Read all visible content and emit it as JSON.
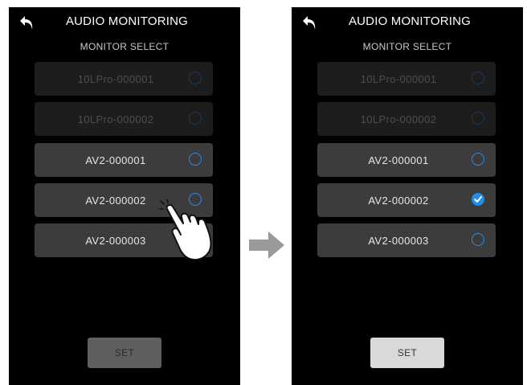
{
  "screens": [
    {
      "title": "AUDIO MONITORING",
      "subtitle": "MONITOR SELECT",
      "items": [
        {
          "label": "10LPro-000001",
          "disabled": true,
          "checked": false
        },
        {
          "label": "10LPro-000002",
          "disabled": true,
          "checked": false
        },
        {
          "label": "AV2-000001",
          "disabled": false,
          "checked": false
        },
        {
          "label": "AV2-000002",
          "disabled": false,
          "checked": false
        },
        {
          "label": "AV2-000003",
          "disabled": false,
          "checked": false
        }
      ],
      "set_label": "SET",
      "set_enabled": false
    },
    {
      "title": "AUDIO MONITORING",
      "subtitle": "MONITOR SELECT",
      "items": [
        {
          "label": "10LPro-000001",
          "disabled": true,
          "checked": false
        },
        {
          "label": "10LPro-000002",
          "disabled": true,
          "checked": false
        },
        {
          "label": "AV2-000001",
          "disabled": false,
          "checked": false
        },
        {
          "label": "AV2-000002",
          "disabled": false,
          "checked": true
        },
        {
          "label": "AV2-000003",
          "disabled": false,
          "checked": false
        }
      ],
      "set_label": "SET",
      "set_enabled": true
    }
  ],
  "icons": {
    "back": "back-arrow-icon",
    "transition": "right-arrow-icon",
    "gesture": "tapping-hand-icon",
    "check": "checkmark-icon"
  },
  "colors": {
    "accent": "#1f8cf0",
    "screen_bg": "#000000",
    "item_bg": "#3c3c3c",
    "item_disabled_bg": "#1d1d1d"
  }
}
